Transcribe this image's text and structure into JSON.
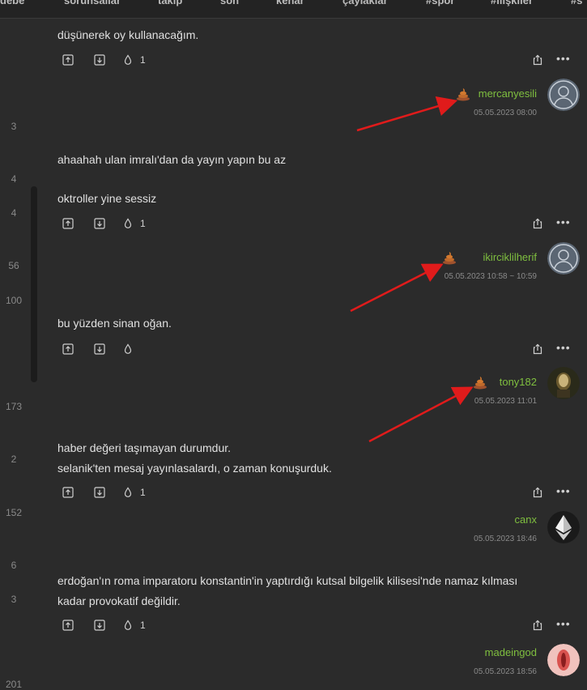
{
  "nav": [
    "debe",
    "sorunsallar",
    "takip",
    "son",
    "kenar",
    "çaylaklar",
    "#spor",
    "#ilişkiler",
    "#s"
  ],
  "left_numbers": [
    "3",
    "4",
    "4",
    "56",
    "100",
    "173",
    "2",
    "152",
    "6",
    "3",
    "201"
  ],
  "entries": [
    {
      "lines": [
        "düşünerek oy kullanacağım."
      ],
      "fav_count": "1",
      "author": "mercanyesili",
      "date": "05.05.2023 08:00",
      "badge": "poo-icon"
    },
    {
      "lines": [
        "ahaahah ulan imralı'dan da yayın yapın bu az",
        "",
        "oktroller yine sessiz"
      ],
      "fav_count": "1",
      "author": "ikirciklilherif",
      "date": "05.05.2023 10:58 ~ 10:59",
      "badge": "poo-icon"
    },
    {
      "lines": [
        "bu yüzden sinan oğan."
      ],
      "fav_count": "",
      "author": "tony182",
      "date": "05.05.2023 11:01",
      "badge": "poo-icon"
    },
    {
      "lines": [
        "haber değeri taşımayan durumdur.",
        "selanik'ten mesaj yayınlasalardı, o zaman konuşurduk."
      ],
      "fav_count": "1",
      "author": "canx",
      "date": "05.05.2023 18:46"
    },
    {
      "lines": [
        "erdoğan'ın roma imparatoru konstantin'in yaptırdığı kutsal bilgelik kilisesi'nde namaz kılması",
        "kadar provokatif değildir."
      ],
      "fav_count": "1",
      "author": "madeingod",
      "date": "05.05.2023 18:56"
    }
  ],
  "colors": {
    "background": "#2b2b2b",
    "author": "#7fbf3f",
    "arrow": "#e01b1b",
    "text": "#e0e0e0"
  }
}
